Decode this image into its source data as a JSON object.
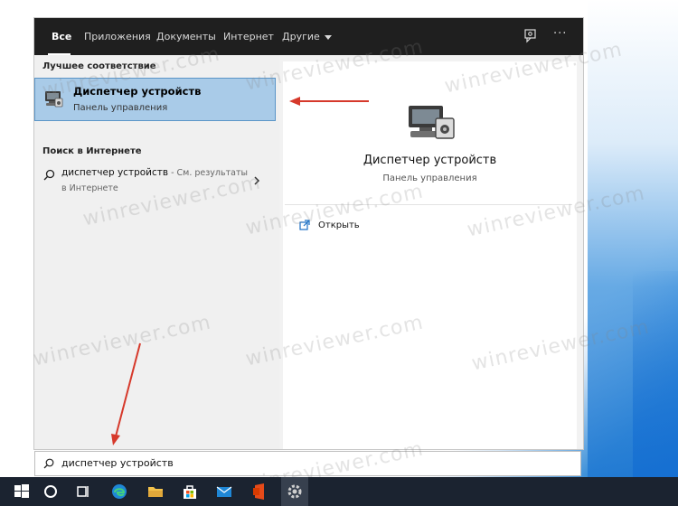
{
  "colors": {
    "accent_highlight": "#a9cbe8",
    "topbar": "#1f1f1f",
    "taskbar": "#1b2330",
    "arrow": "#d6392b"
  },
  "tabs": [
    {
      "label": "Все",
      "active": true
    },
    {
      "label": "Приложения"
    },
    {
      "label": "Документы"
    },
    {
      "label": "Интернет"
    },
    {
      "label": "Другие"
    }
  ],
  "top_icons": [
    "feedback-icon",
    "more-options-icon"
  ],
  "left": {
    "best_match_heading": "Лучшее соответствие",
    "best_match": {
      "title": "Диспетчер устройств",
      "subtitle": "Панель управления",
      "icon": "device-manager-icon"
    },
    "web_heading": "Поиск в Интернете",
    "web_result": {
      "query": "диспетчер устройств",
      "hint": " - См. результаты",
      "hint_line2": "в Интернете",
      "icon": "search-icon"
    }
  },
  "right": {
    "title": "Диспетчер устройств",
    "subtitle": "Панель управления",
    "actions": [
      {
        "label": "Открыть",
        "icon": "open-icon"
      }
    ]
  },
  "search": {
    "value": "диспетчер устройств"
  },
  "taskbar": {
    "items": [
      "windows-start-icon",
      "cortana-icon",
      "task-view-icon",
      "edge-icon",
      "file-explorer-icon",
      "store-icon",
      "mail-icon",
      "office-icon",
      "settings-icon"
    ]
  },
  "watermark": "winreviewer.com"
}
